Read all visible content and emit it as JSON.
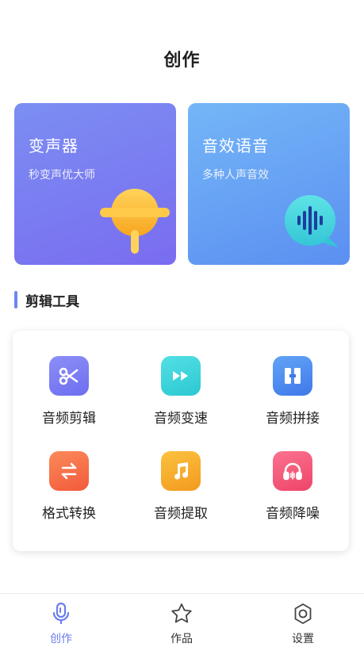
{
  "header": {
    "title": "创作"
  },
  "cards": [
    {
      "title": "变声器",
      "subtitle": "秒变声优大师",
      "icon": "lollipop-icon"
    },
    {
      "title": "音效语音",
      "subtitle": "多种人声音效",
      "icon": "sound-wave-bubble-icon"
    }
  ],
  "section": {
    "title": "剪辑工具"
  },
  "tools": [
    {
      "label": "音频剪辑",
      "icon": "scissors-icon",
      "color": "#7d7ef3"
    },
    {
      "label": "音频变速",
      "icon": "fast-forward-icon",
      "color": "#38d3d8"
    },
    {
      "label": "音频拼接",
      "icon": "splice-icon",
      "color": "#4f8cf0"
    },
    {
      "label": "格式转换",
      "icon": "convert-arrows-icon",
      "color": "#f66b4a"
    },
    {
      "label": "音频提取",
      "icon": "music-note-icon",
      "color": "#f7b12d"
    },
    {
      "label": "音频降噪",
      "icon": "headphones-icon",
      "color": "#f2597a"
    }
  ],
  "tabbar": {
    "items": [
      {
        "label": "创作",
        "icon": "microphone-icon",
        "active": true
      },
      {
        "label": "作品",
        "icon": "star-icon",
        "active": false
      },
      {
        "label": "设置",
        "icon": "gear-icon",
        "active": false
      }
    ],
    "active_color": "#6b7cf0"
  }
}
